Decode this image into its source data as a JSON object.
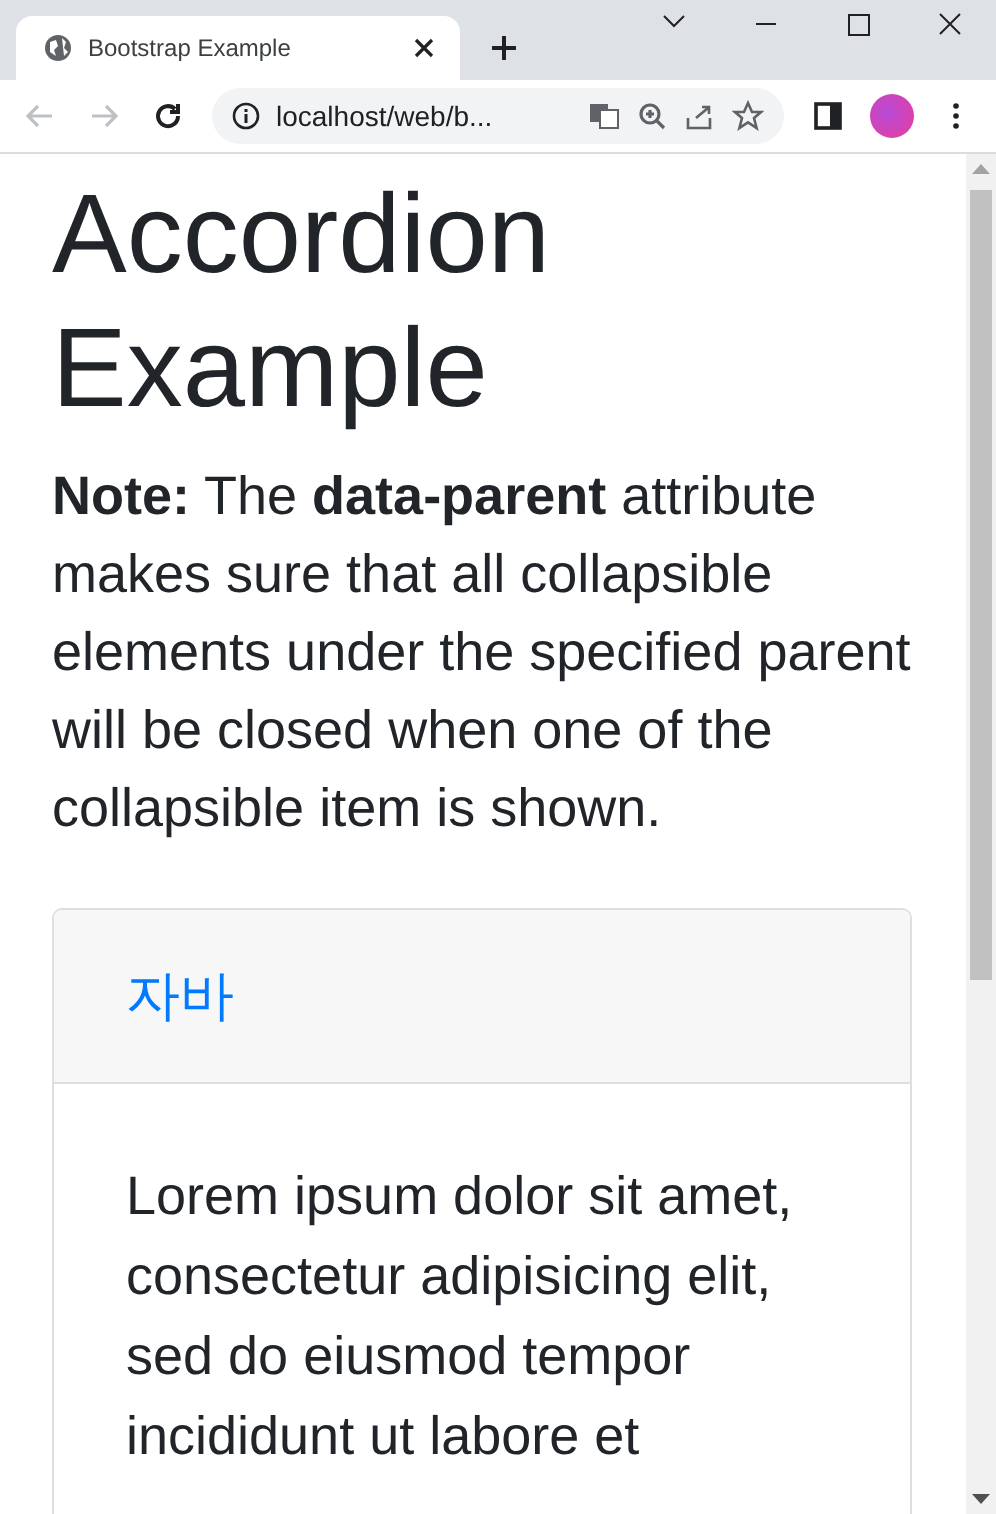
{
  "browser": {
    "tab_title": "Bootstrap Example",
    "address": "localhost/web/b..."
  },
  "page": {
    "heading": "Accordion Example",
    "note": "**Note:** The **data-parent** attribute makes sure that all collapsible elements under the specified parent will be closed when one of the collapsible item is shown.",
    "accordion": [
      {
        "title": "자바",
        "expanded": true,
        "body": "Lorem ipsum dolor sit amet, consectetur adipisicing elit, sed do eiusmod tempor incididunt ut labore et"
      }
    ]
  }
}
